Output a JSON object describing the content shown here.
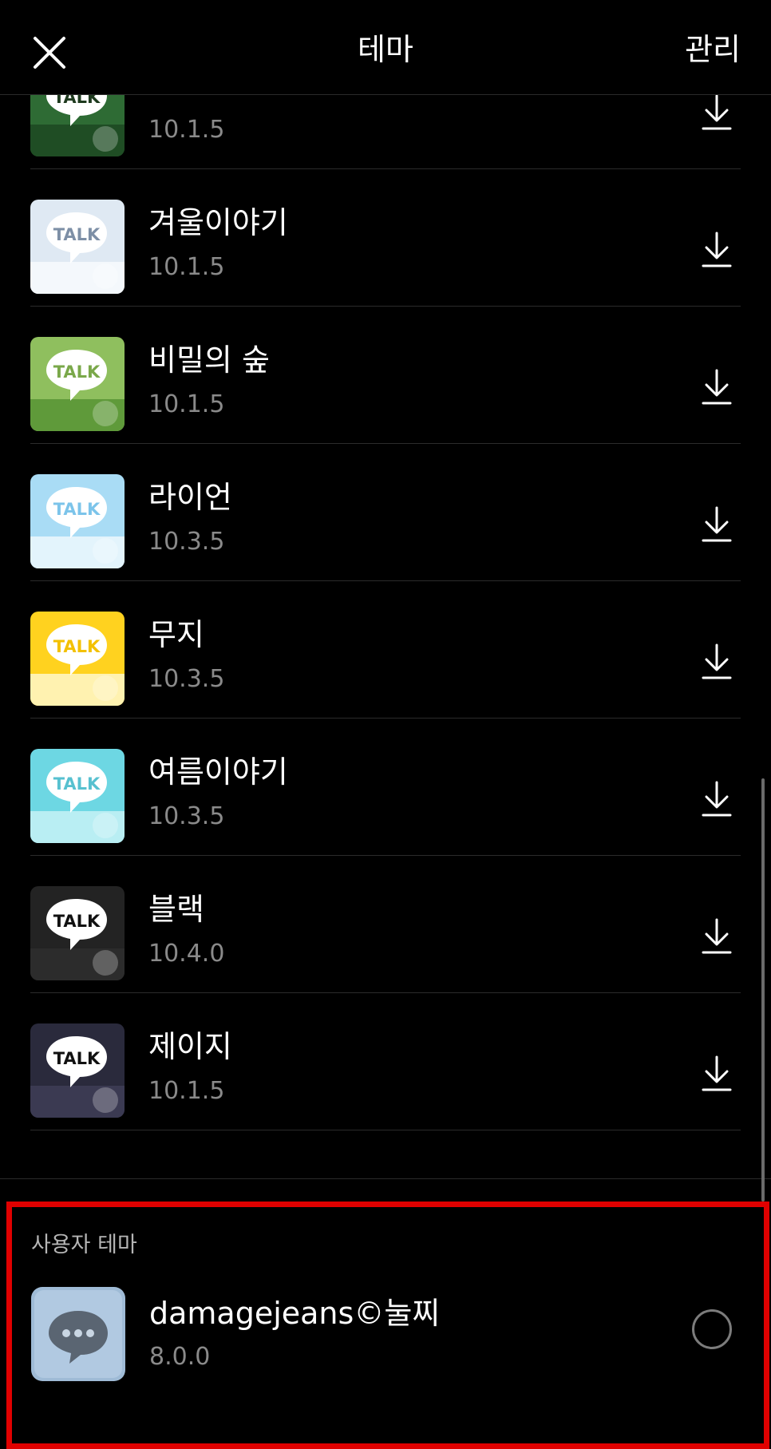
{
  "header": {
    "title": "테마",
    "manage_label": "관리"
  },
  "themes": [
    {
      "name": "",
      "version": "10.1.5",
      "colors": {
        "bg": "#2e6b34",
        "bg2": "#1f4d24",
        "bubble": "#ffffff",
        "text": "#1e3a1e"
      }
    },
    {
      "name": "겨울이야기",
      "version": "10.1.5",
      "colors": {
        "bg": "#dfe9f3",
        "bg2": "#f4f8fc",
        "bubble": "#ffffff",
        "text": "#7d8fa6"
      }
    },
    {
      "name": "비밀의 숲",
      "version": "10.1.5",
      "colors": {
        "bg": "#8fbf5e",
        "bg2": "#5f9a3a",
        "bubble": "#ffffff",
        "text": "#7aa84a"
      }
    },
    {
      "name": "라이언",
      "version": "10.3.5",
      "colors": {
        "bg": "#a9dcf5",
        "bg2": "#e3f4fc",
        "bubble": "#ffffff",
        "text": "#7cc4ea"
      }
    },
    {
      "name": "무지",
      "version": "10.3.5",
      "colors": {
        "bg": "#ffd21f",
        "bg2": "#fff2b0",
        "bubble": "#ffffff",
        "text": "#f3c100"
      }
    },
    {
      "name": "여름이야기",
      "version": "10.3.5",
      "colors": {
        "bg": "#6dd7e3",
        "bg2": "#b9eef3",
        "bubble": "#ffffff",
        "text": "#57c1d0"
      }
    },
    {
      "name": "블랙",
      "version": "10.4.0",
      "colors": {
        "bg": "#232323",
        "bg2": "#2c2c2c",
        "bubble": "#ffffff",
        "text": "#111111"
      }
    },
    {
      "name": "제이지",
      "version": "10.1.5",
      "colors": {
        "bg": "#2a2a3c",
        "bg2": "#3b3a52",
        "bubble": "#ffffff",
        "text": "#111111"
      }
    }
  ],
  "thumb_label": "TALK",
  "user_section": {
    "label": "사용자 테마",
    "theme": {
      "name": "damagejeans©눌찌",
      "version": "8.0.0",
      "colors": {
        "bg": "#a9c3dc",
        "bubble": "#5a6572"
      }
    }
  },
  "icons": {
    "close": "close-icon",
    "download": "download-icon",
    "radio": "radio-unselected"
  }
}
